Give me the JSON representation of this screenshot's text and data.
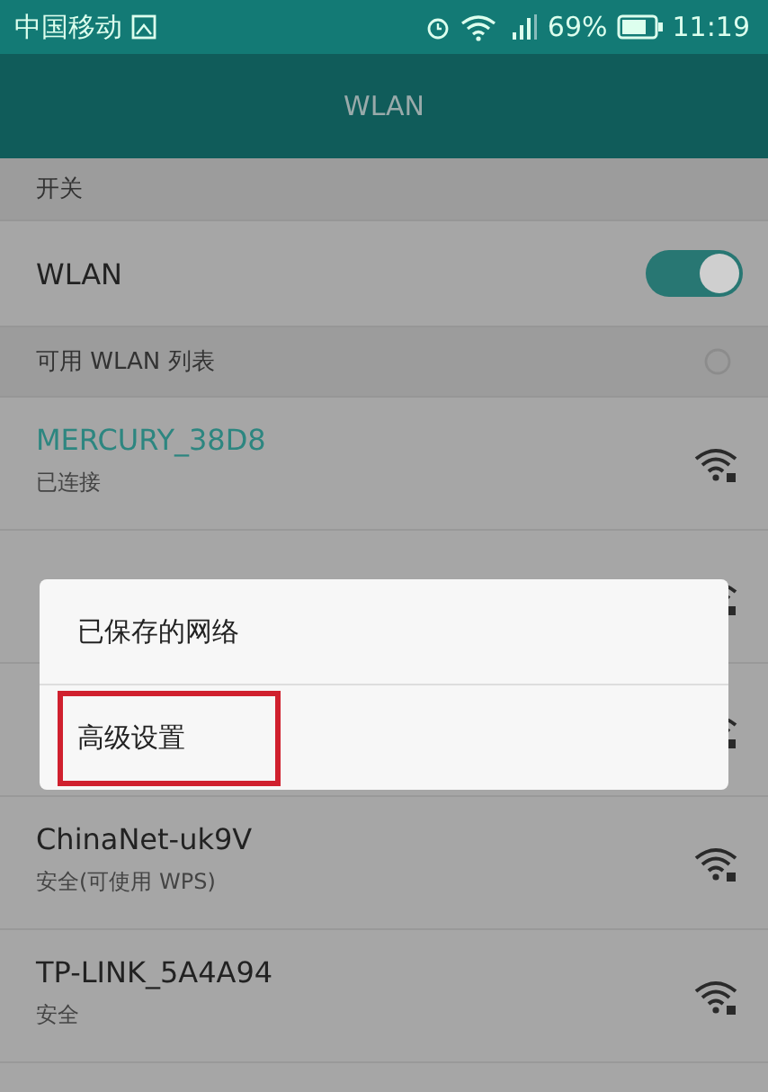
{
  "status_bar": {
    "carrier": "中国移动",
    "battery": "69%",
    "time": "11:19"
  },
  "title": "WLAN",
  "switch_section": {
    "header": "开关",
    "label": "WLAN",
    "on": true
  },
  "list_header": "可用 WLAN 列表",
  "networks": [
    {
      "kind": "network",
      "name": "MERCURY_38D8",
      "status": "已连接",
      "connected": true
    },
    {
      "kind": "covered"
    },
    {
      "kind": "covered"
    },
    {
      "kind": "network",
      "name": "ChinaNet-uk9V",
      "status": "安全(可使用 WPS)",
      "connected": false
    },
    {
      "kind": "network",
      "name": "TP-LINK_5A4A94",
      "status": "安全",
      "connected": false
    }
  ],
  "menu": [
    {
      "label": "已保存的网络",
      "highlighted": false
    },
    {
      "label": "高级设置",
      "highlighted": true
    }
  ]
}
